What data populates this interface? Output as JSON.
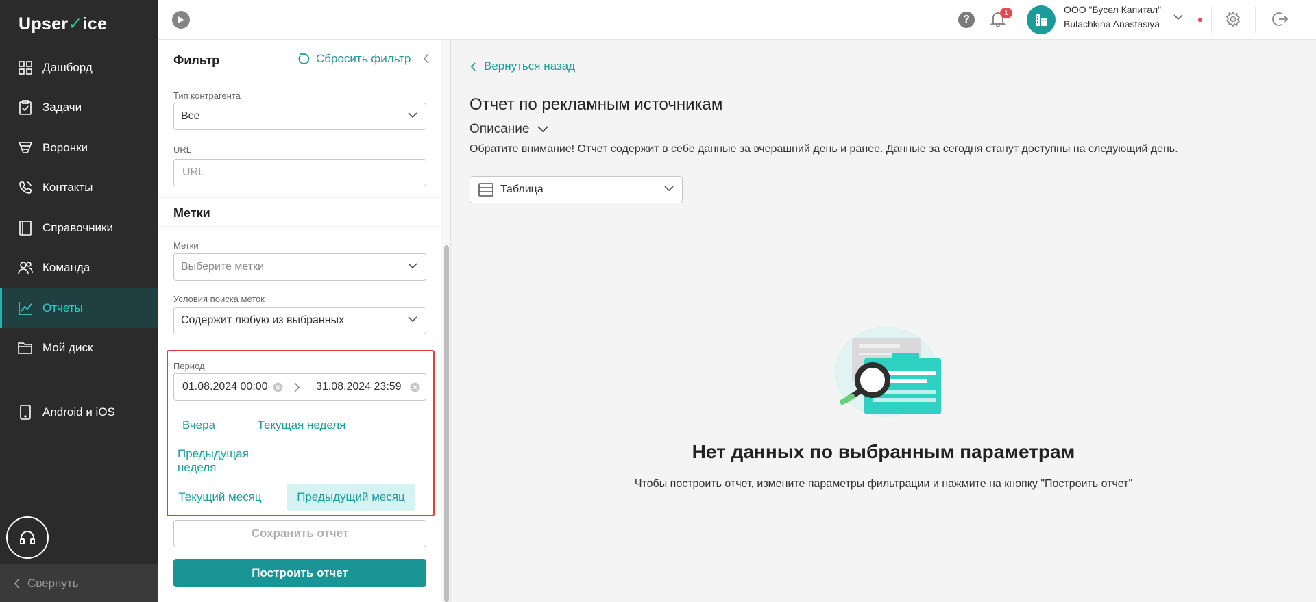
{
  "brand": {
    "logo_pre": "Upser",
    "logo_check": "✓",
    "logo_post": "ice"
  },
  "sidebar": {
    "items": [
      {
        "label": "Дашборд",
        "icon": "dashboard-icon"
      },
      {
        "label": "Задачи",
        "icon": "clipboard-icon"
      },
      {
        "label": "Воронки",
        "icon": "funnel-icon"
      },
      {
        "label": "Контакты",
        "icon": "phone-icon"
      },
      {
        "label": "Справочники",
        "icon": "book-icon"
      },
      {
        "label": "Команда",
        "icon": "team-icon"
      },
      {
        "label": "Отчеты",
        "icon": "chart-line-icon",
        "active": true
      },
      {
        "label": "Мой диск",
        "icon": "folder-icon"
      },
      {
        "label": "Android и iOS",
        "icon": "mobile-icon"
      }
    ],
    "collapse_label": "Свернуть"
  },
  "topbar": {
    "help_label": "?",
    "notification_count": "1",
    "company": "ООО \"Бусел Капитал\"",
    "user": "Bulachkina Anastasiya"
  },
  "filter": {
    "title": "Фильтр",
    "reset_label": "Сбросить фильтр",
    "counterparty_type": {
      "label": "Тип контрагента",
      "value": "Все"
    },
    "url": {
      "label": "URL",
      "placeholder": "URL"
    },
    "tags_section_title": "Метки",
    "tags": {
      "label": "Метки",
      "placeholder": "Выберите метки"
    },
    "tag_conditions": {
      "label": "Условия поиска меток",
      "value": "Содержит любую из выбранных"
    },
    "period": {
      "label": "Период",
      "start": "01.08.2024 00:00",
      "end": "31.08.2024 23:59",
      "presets": [
        {
          "label": "Вчера",
          "selected": false
        },
        {
          "label": "Текущая неделя",
          "selected": false
        },
        {
          "label": "Предыдущая неделя",
          "selected": false
        },
        {
          "label": "Текущий месяц",
          "selected": false
        },
        {
          "label": "Предыдущий месяц",
          "selected": true
        }
      ]
    },
    "save_label": "Сохранить отчет",
    "build_label": "Построить отчет"
  },
  "main": {
    "back_label": "Вернуться назад",
    "title": "Отчет по рекламным источникам",
    "description_toggle": "Описание",
    "notice": "Обратите внимание! Отчет содержит в себе данные за вчерашний день и ранее. Данные за сегодня станут доступны на следующий день.",
    "view_select": "Таблица",
    "empty_title": "Нет данных по выбранным параметрам",
    "empty_hint": "Чтобы построить отчет, измените параметры фильтрации и нажмите на кнопку \"Построить отчет\""
  },
  "colors": {
    "sidebar_bg": "#2b2b2b",
    "accent": "#1a9e9a",
    "primary_button": "#1a9595",
    "active_nav_bg": "#1f3f41",
    "highlight_border": "#e03c3c",
    "badge": "#e5484d"
  }
}
